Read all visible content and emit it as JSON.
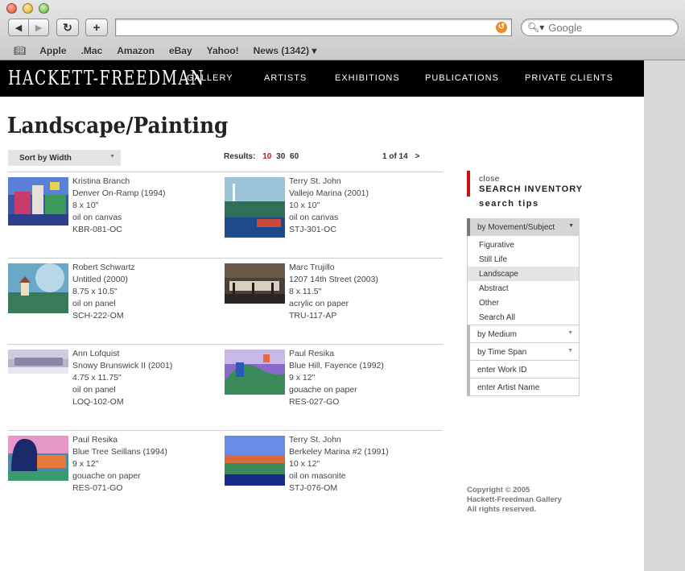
{
  "browser": {
    "bookmarks": [
      "Apple",
      ".Mac",
      "Amazon",
      "eBay",
      "Yahoo!",
      "News (1342) ▾"
    ],
    "search_placeholder": "Google",
    "address": ""
  },
  "site": {
    "logo": "HACKETT-FREEDMAN",
    "nav": [
      "GALLERY",
      "ARTISTS",
      "EXHIBITIONS",
      "PUBLICATIONS",
      "PRIVATE CLIENTS"
    ]
  },
  "page_title": "Landscape/Painting",
  "sort": {
    "label": "Sort by Width"
  },
  "results": {
    "label": "Results:",
    "options": [
      "10",
      "30",
      "60"
    ],
    "active": "10"
  },
  "pager": {
    "text": "1 of 14",
    "next": ">"
  },
  "artworks": [
    {
      "artist": "Kristina Branch",
      "title": "Denver On-Ramp (1994)",
      "size": "8 x 10\"",
      "medium": "oil on canvas",
      "code": "KBR-081-OC"
    },
    {
      "artist": "Terry St. John",
      "title": "Vallejo Marina (2001)",
      "size": "10 x 10\"",
      "medium": "oil on canvas",
      "code": "STJ-301-OC"
    },
    {
      "artist": "Robert Schwartz",
      "title": "Untitled (2000)",
      "size": "8.75 x 10.5\"",
      "medium": "oil on panel",
      "code": "SCH-222-OM"
    },
    {
      "artist": "Marc Trujillo",
      "title": "1207 14th Street (2003)",
      "size": "8 x 11.5\"",
      "medium": "acrylic on paper",
      "code": "TRU-117-AP"
    },
    {
      "artist": "Ann Lofquist",
      "title": "Snowy Brunswick II (2001)",
      "size": "4.75 x 11.75\"",
      "medium": "oil on panel",
      "code": "LOQ-102-OM"
    },
    {
      "artist": "Paul Resika",
      "title": "Blue Hill, Fayence (1992)",
      "size": "9 x 12\"",
      "medium": "gouache on paper",
      "code": "RES-027-GO"
    },
    {
      "artist": "Paul Resika",
      "title": "Blue Tree Seillans (1994)",
      "size": "9 x 12\"",
      "medium": "gouache on paper",
      "code": "RES-071-GO"
    },
    {
      "artist": "Terry St. John",
      "title": "Berkeley Marina #2 (1991)",
      "size": "10 x 12\"",
      "medium": "oil on masonite",
      "code": "STJ-076-OM"
    }
  ],
  "panel": {
    "close": "close",
    "title": "SEARCH INVENTORY",
    "tips": "search tips",
    "movement": {
      "label": "by Movement/Subject",
      "options": [
        "Figurative",
        "Still Life",
        "Landscape",
        "Abstract",
        "Other",
        "Search All"
      ],
      "selected": "Landscape"
    },
    "medium": "by Medium",
    "time_span": "by Time Span",
    "work_id": "enter Work ID",
    "artist_name": "enter Artist Name"
  },
  "copyright": [
    "Copyright © 2005",
    "Hackett-Freedman Gallery",
    "All rights reserved."
  ],
  "colors": {
    "accent_red": "#cc1111",
    "header_bg": "#000000"
  }
}
